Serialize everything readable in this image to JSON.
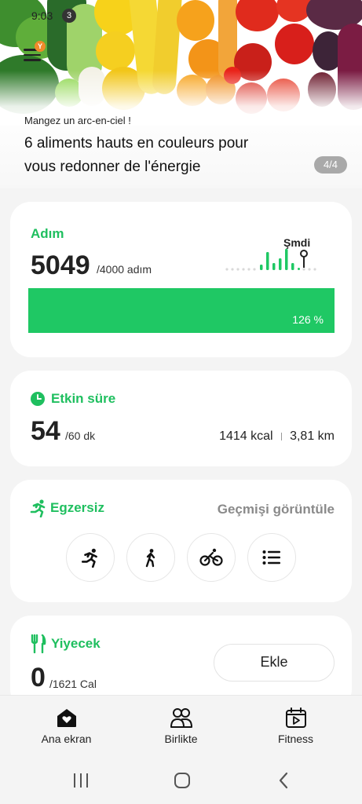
{
  "status_bar": {
    "time": "9:03",
    "notification_count": "3",
    "battery": ""
  },
  "hero": {
    "menu_badge": "Y",
    "eyebrow": "Mangez un arc-en-ciel !",
    "title": "6 aliments hauts en couleurs pour vous redonner de l'énergie",
    "page_indicator": "4/4"
  },
  "steps": {
    "title": "Adım",
    "value": "5049",
    "goal": "/4000 adım",
    "now_label": "Şmdi",
    "percent_label": "126 %",
    "progress_fraction": 1.0,
    "accent_color": "#1fc864"
  },
  "active_time": {
    "title": "Etkin süre",
    "value": "54",
    "goal": "/60 dk",
    "calories": "1414 kcal",
    "distance": "3,81 km"
  },
  "exercise": {
    "title": "Egzersiz",
    "history_label": "Geçmişi görüntüle",
    "buttons": [
      "running-icon",
      "walking-icon",
      "cycling-icon",
      "list-icon"
    ]
  },
  "food": {
    "title": "Yiyecek",
    "value": "0",
    "goal": "/1621 Cal",
    "add_label": "Ekle"
  },
  "bottom_nav": {
    "items": [
      {
        "label": "Ana ekran",
        "icon": "home-heart-icon"
      },
      {
        "label": "Birlikte",
        "icon": "people-icon"
      },
      {
        "label": "Fitness",
        "icon": "fitness-play-icon"
      }
    ]
  },
  "system_nav": [
    "recents-icon",
    "home-icon",
    "back-icon"
  ]
}
